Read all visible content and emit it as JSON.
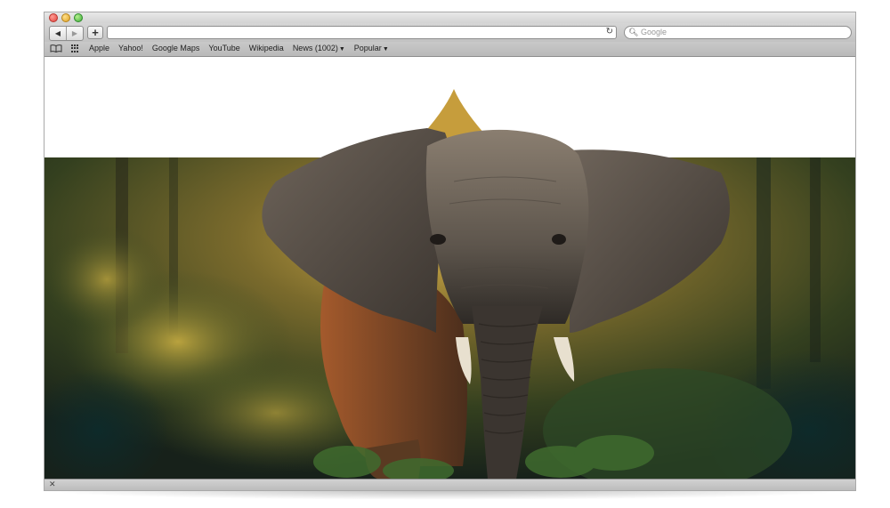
{
  "window": {
    "title": ""
  },
  "toolbar": {
    "back_icon": "back-arrow-icon",
    "forward_icon": "forward-arrow-icon",
    "add_icon": "plus-icon",
    "address_value": "",
    "reload_icon": "reload-icon",
    "search_placeholder": "Google"
  },
  "bookmarks": {
    "items": [
      {
        "label": "Apple"
      },
      {
        "label": "Yahoo!"
      },
      {
        "label": "Google Maps"
      },
      {
        "label": "YouTube"
      },
      {
        "label": "Wikipedia"
      },
      {
        "label": "News (1002)",
        "dropdown": true
      },
      {
        "label": "Popular",
        "dropdown": true
      }
    ]
  },
  "content": {
    "image_subject": "elephant in forest",
    "colors": {
      "forest_dark": "#1f2a18",
      "forest_light": "#c9a43a",
      "elephant": "#6b6157"
    }
  },
  "statusbar": {
    "close_icon": "close-icon"
  }
}
